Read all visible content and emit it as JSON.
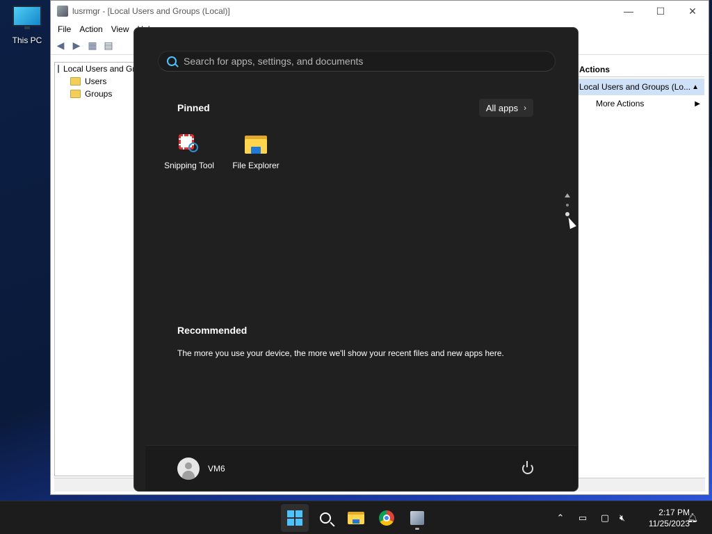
{
  "desktop": {
    "icons": [
      {
        "label": "This PC",
        "icon": "monitor-icon"
      }
    ]
  },
  "mmc_window": {
    "title": "lusrmgr - [Local Users and Groups (Local)]",
    "controls": {
      "minimize": "—",
      "maximize": "☐",
      "close": "✕"
    },
    "menu": [
      "File",
      "Action",
      "View",
      "Help"
    ],
    "tree": {
      "root": "Local Users and Groups (Local)",
      "children": [
        "Users",
        "Groups"
      ]
    },
    "actions": {
      "header": "Actions",
      "selected": "Local Users and Groups (Lo...",
      "items": [
        "More Actions"
      ]
    }
  },
  "start_menu": {
    "search_placeholder": "Search for apps, settings, and documents",
    "pinned_title": "Pinned",
    "all_apps_label": "All apps",
    "pinned_apps": [
      {
        "label": "Snipping Tool",
        "icon": "snipping-tool-icon"
      },
      {
        "label": "File Explorer",
        "icon": "file-explorer-icon"
      }
    ],
    "recommended_title": "Recommended",
    "recommended_text": "The more you use your device, the more we'll show your recent files and new apps here.",
    "user_name": "VM6",
    "page_indicator": {
      "pages": 2,
      "current_page": 2
    }
  },
  "taskbar": {
    "apps": [
      {
        "name": "start",
        "icon": "windows-logo-icon"
      },
      {
        "name": "search",
        "icon": "search-icon"
      },
      {
        "name": "file-explorer",
        "icon": "folder-icon"
      },
      {
        "name": "chrome",
        "icon": "chrome-icon"
      },
      {
        "name": "lusrmgr",
        "icon": "mmc-icon"
      }
    ],
    "time": "2:17 PM",
    "date": "11/25/2023"
  },
  "colors": {
    "accent": "#4cc2ff",
    "start_bg": "#202020",
    "taskbar_bg": "#1c1c1c"
  }
}
